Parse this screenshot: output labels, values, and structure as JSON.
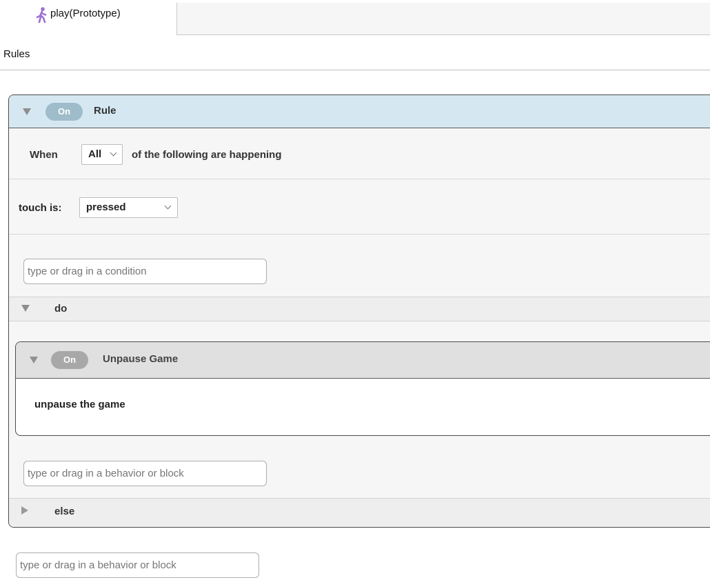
{
  "tab": {
    "label": "play(Prototype)",
    "icon": "walking-person-icon",
    "icon_color": "#9b6fd6"
  },
  "rules_heading": "Rules",
  "rule": {
    "toggle_label": "On",
    "title": "Rule",
    "when_label": "When",
    "match_select": {
      "value": "All"
    },
    "when_suffix": "of the following are happening",
    "condition": {
      "label": "touch is:",
      "select": {
        "value": "pressed"
      }
    },
    "condition_input": {
      "placeholder": "type or drag in a condition"
    },
    "do_label": "do",
    "behavior": {
      "toggle_label": "On",
      "title": "Unpause Game",
      "body": "unpause the game"
    },
    "behavior_input": {
      "placeholder": "type or drag in a behavior or block"
    },
    "else_label": "else"
  },
  "outer_input": {
    "placeholder": "type or drag in a behavior or block"
  },
  "colors": {
    "rule_header_bg": "#d5e8f2",
    "behavior_header_bg": "#e0e0e0",
    "on_pill_rule": "#9fbccb",
    "on_pill_behavior": "#a8a8a8"
  }
}
